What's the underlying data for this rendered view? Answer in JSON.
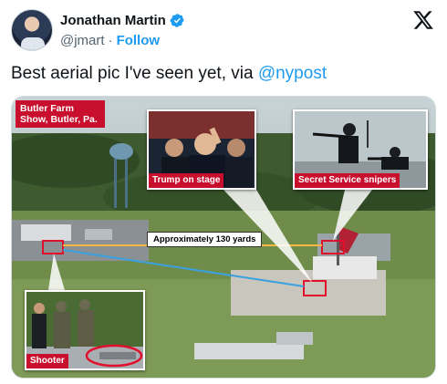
{
  "author": {
    "display_name": "Jonathan Martin",
    "handle": "@jmart",
    "separator": "·",
    "follow_label": "Follow",
    "verified_icon": "verified-badge-icon"
  },
  "tweet": {
    "text_before": "Best aerial pic I've seen yet, via ",
    "mention": "@nypost"
  },
  "media": {
    "venue_label": "Butler Farm Show, Butler, Pa.",
    "distance_label": "Approximately 130 yards",
    "inset_stage_label": "Trump on stage",
    "inset_snipers_label": "Secret Service snipers",
    "inset_shooter_label": "Shooter"
  },
  "colors": {
    "accent": "#1d9bf0",
    "label_red": "#c8102e",
    "text": "#0f1419",
    "muted": "#536471"
  }
}
